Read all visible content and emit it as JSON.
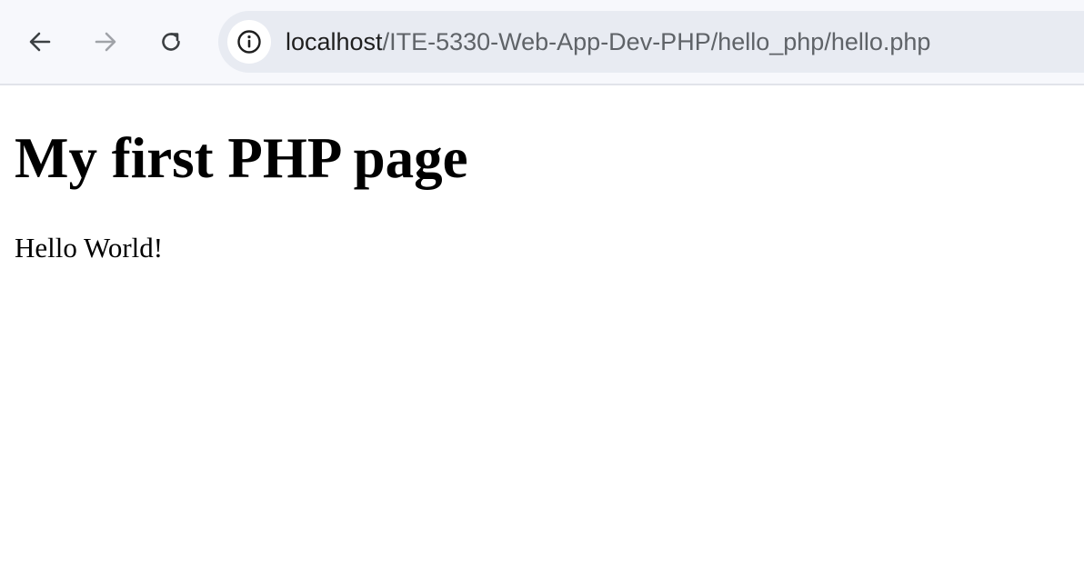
{
  "browser": {
    "url_host": "localhost",
    "url_path": "/ITE-5330-Web-App-Dev-PHP/hello_php/hello.php",
    "icons": {
      "back": "back-arrow-icon",
      "forward": "forward-arrow-icon",
      "reload": "reload-icon",
      "site_info": "info-icon"
    },
    "colors": {
      "toolbar_bg": "#f7f8fc",
      "omnibox_bg": "#e8ebf2"
    }
  },
  "page": {
    "heading": "My first PHP page",
    "body_text": "Hello World!"
  }
}
